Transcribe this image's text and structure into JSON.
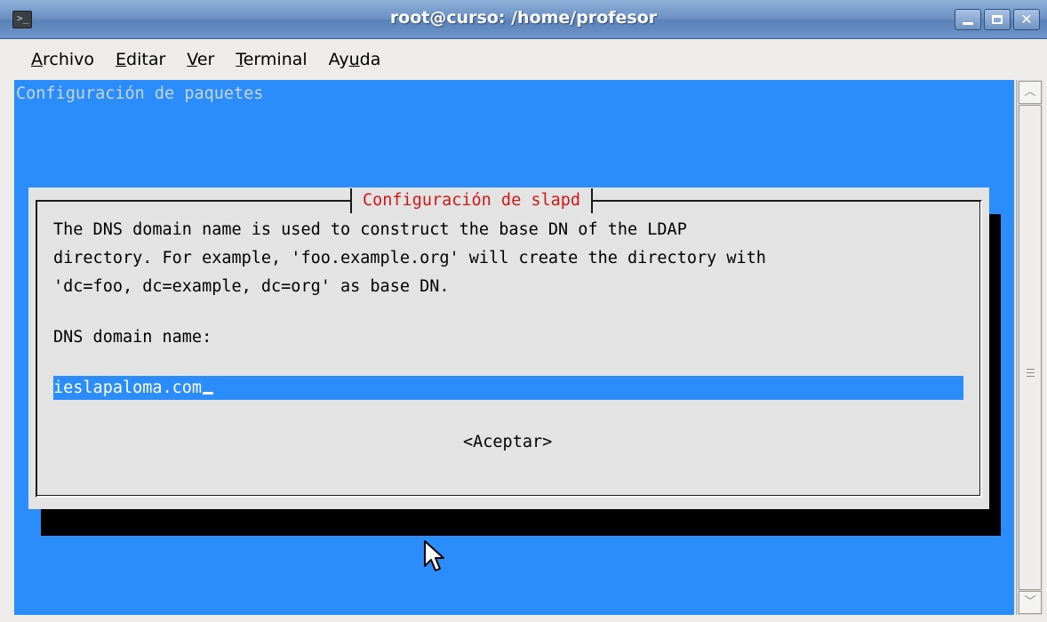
{
  "window": {
    "title": "root@curso: /home/profesor",
    "icon": "terminal-icon",
    "controls": [
      "minimize-icon",
      "maximize-icon",
      "close-icon"
    ]
  },
  "menu": [
    {
      "accel": "A",
      "rest": "rchivo"
    },
    {
      "accel": "E",
      "rest": "ditar"
    },
    {
      "accel": "V",
      "rest": "er"
    },
    {
      "accel": "T",
      "rest": "erminal"
    },
    {
      "pre": "Ay",
      "accel": "u",
      "rest": "da"
    }
  ],
  "terminal": {
    "header": "Configuración de paquetes",
    "dialog": {
      "title": "Configuración de slapd",
      "lines": [
        "The DNS domain name is used to construct the base DN of the LDAP",
        "directory. For example, 'foo.example.org' will create the directory with",
        "'dc=foo, dc=example, dc=org' as base DN."
      ],
      "label": "DNS domain name:",
      "input_value": "ieslapaloma.com",
      "button": "<Aceptar>"
    }
  },
  "colors": {
    "terminal_bg": "#2a8dfb",
    "dialog_bg": "#e3e3e3",
    "dialog_title": "#d01818",
    "header_text": "#c9d6e6"
  }
}
